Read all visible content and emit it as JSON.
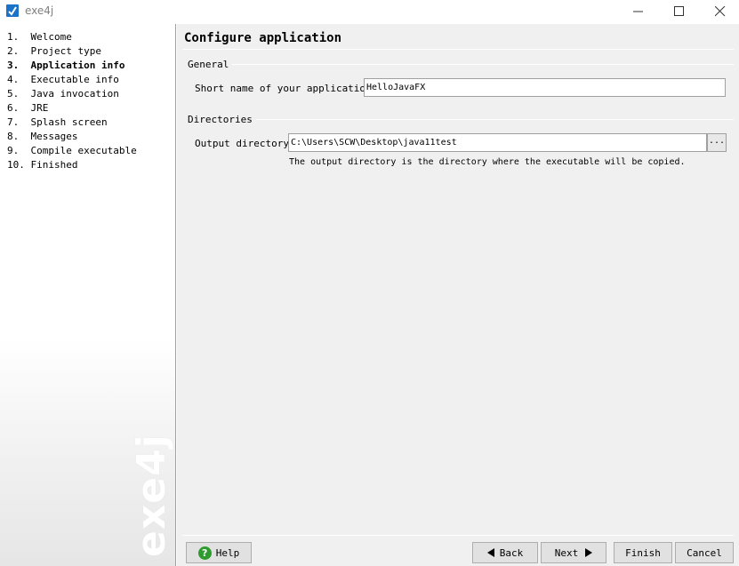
{
  "window": {
    "title": "exe4j",
    "icon": "exe4j-app-icon",
    "controls": [
      "minimize-icon",
      "maximize-icon",
      "close-icon"
    ]
  },
  "sidebar": {
    "steps": [
      "1.  Welcome",
      "2.  Project type",
      "3.  Application info",
      "4.  Executable info",
      "5.  Java invocation",
      "6.  JRE",
      "7.  Splash screen",
      "8.  Messages",
      "9.  Compile executable",
      "10. Finished"
    ],
    "active_index": 2,
    "watermark": "exe4j"
  },
  "main": {
    "title": "Configure application",
    "general": {
      "group_label": "General",
      "short_name_label": "Short name of your application:",
      "short_name_value": "HelloJavaFX"
    },
    "directories": {
      "group_label": "Directories",
      "output_label": "Output directory:",
      "output_value": "C:\\Users\\SCW\\Desktop\\java11test",
      "browse_label": "...",
      "help_text": "The output directory is the directory where the executable will be copied."
    }
  },
  "footer": {
    "help_label": "Help",
    "back_label": "Back",
    "next_label": "Next",
    "finish_label": "Finish",
    "cancel_label": "Cancel"
  },
  "colors": {
    "main_bg": "#f0f0f0",
    "help_icon": "#2e9b2e",
    "app_icon": "#1a73c9"
  }
}
